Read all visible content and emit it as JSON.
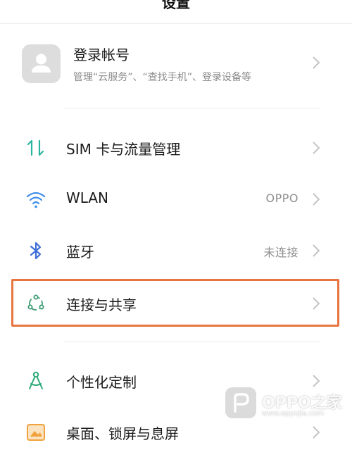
{
  "header": {
    "title": "设置"
  },
  "account": {
    "name": "登录帐号",
    "subtitle": "管理“云服务”、“查找手机”、登录设备等",
    "avatar_icon": "person-icon"
  },
  "items": [
    {
      "label": "SIM 卡与流量管理",
      "value": "",
      "icon": "sim-data-icon",
      "icon_color": "#2bb5a0"
    },
    {
      "label": "WLAN",
      "value": "OPPO",
      "icon": "wifi-icon",
      "icon_color": "#3f8ee8"
    },
    {
      "label": "蓝牙",
      "value": "未连接",
      "icon": "bluetooth-icon",
      "icon_color": "#3f6fd6"
    },
    {
      "label": "连接与共享",
      "value": "",
      "icon": "connection-sharing-icon",
      "icon_color": "#3d9a72"
    },
    {
      "label": "个性化定制",
      "value": "",
      "icon": "personalization-icon",
      "icon_color": "#2faa7a"
    },
    {
      "label": "桌面、锁屏与息屏",
      "value": "",
      "icon": "home-lock-screen-icon",
      "icon_color": "#f0a23c"
    }
  ],
  "watermark": {
    "text": "OPPO之家",
    "url": "www.oppojia.com"
  },
  "colors": {
    "highlight": "#e8743f",
    "chevron": "#c4c4c4"
  }
}
